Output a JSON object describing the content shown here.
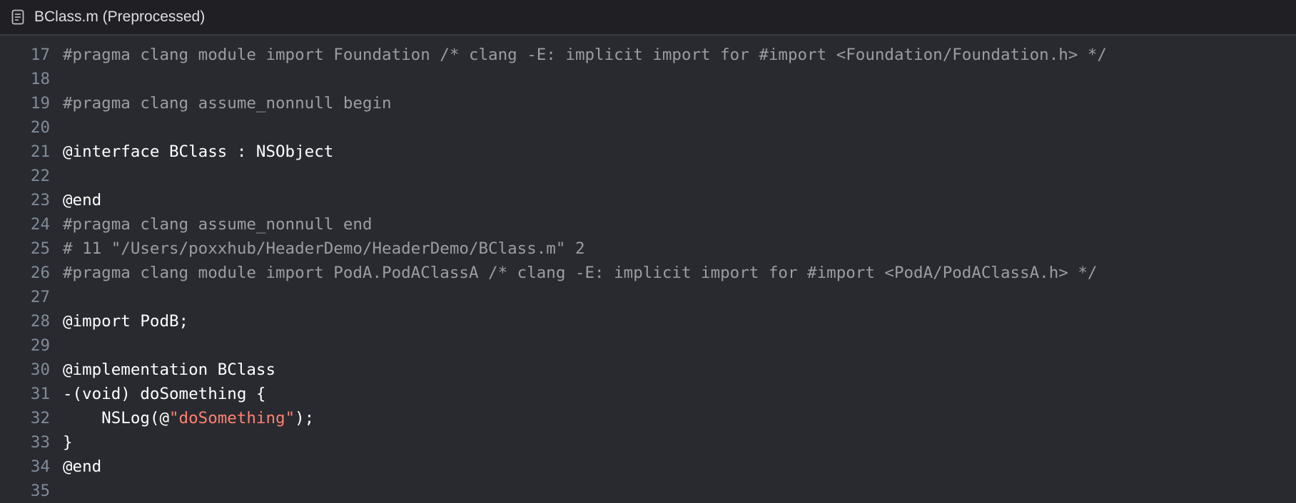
{
  "tab": {
    "title": "BClass.m (Preprocessed)",
    "icon": "document-icon"
  },
  "colors": {
    "background": "#292a30",
    "tabbar": "#1f1f24",
    "line_number": "#7f8c98",
    "preprocessor": "#9a9da3",
    "plain": "#ffffff",
    "string": "#ff8170"
  },
  "lines": [
    {
      "num": "17",
      "tokens": [
        {
          "t": "#pragma clang module import Foundation /* clang -E: implicit import for #import <Foundation/Foundation.h> */",
          "k": "pp"
        }
      ]
    },
    {
      "num": "18",
      "tokens": []
    },
    {
      "num": "19",
      "tokens": [
        {
          "t": "#pragma clang assume_nonnull begin",
          "k": "pp"
        }
      ]
    },
    {
      "num": "20",
      "tokens": []
    },
    {
      "num": "21",
      "tokens": [
        {
          "t": "@interface BClass : NSObject",
          "k": "plain"
        }
      ]
    },
    {
      "num": "22",
      "tokens": []
    },
    {
      "num": "23",
      "tokens": [
        {
          "t": "@end",
          "k": "plain"
        }
      ]
    },
    {
      "num": "24",
      "tokens": [
        {
          "t": "#pragma clang assume_nonnull end",
          "k": "pp"
        }
      ]
    },
    {
      "num": "25",
      "tokens": [
        {
          "t": "# 11 \"/Users/poxxhub/HeaderDemo/HeaderDemo/BClass.m\" 2",
          "k": "pp"
        }
      ]
    },
    {
      "num": "26",
      "tokens": [
        {
          "t": "#pragma clang module import PodA.PodAClassA /* clang -E: implicit import for #import <PodA/PodAClassA.h> */",
          "k": "pp"
        }
      ]
    },
    {
      "num": "27",
      "tokens": []
    },
    {
      "num": "28",
      "tokens": [
        {
          "t": "@import PodB;",
          "k": "plain"
        }
      ]
    },
    {
      "num": "29",
      "tokens": []
    },
    {
      "num": "30",
      "tokens": [
        {
          "t": "@implementation BClass",
          "k": "plain"
        }
      ]
    },
    {
      "num": "31",
      "tokens": [
        {
          "t": "-(void) doSomething {",
          "k": "plain"
        }
      ]
    },
    {
      "num": "32",
      "tokens": [
        {
          "t": "    NSLog(@",
          "k": "plain"
        },
        {
          "t": "\"doSomething\"",
          "k": "str"
        },
        {
          "t": ");",
          "k": "plain"
        }
      ]
    },
    {
      "num": "33",
      "tokens": [
        {
          "t": "}",
          "k": "plain"
        }
      ]
    },
    {
      "num": "34",
      "tokens": [
        {
          "t": "@end",
          "k": "plain"
        }
      ]
    },
    {
      "num": "35",
      "tokens": []
    }
  ]
}
